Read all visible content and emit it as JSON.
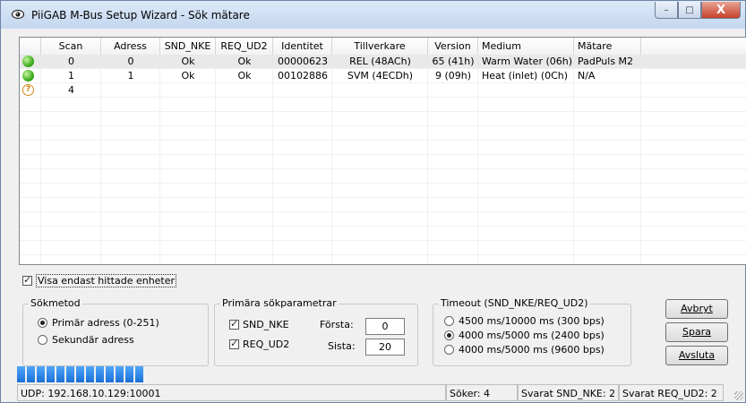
{
  "window": {
    "title": "PiiGAB M-Bus Setup Wizard - Sök mätare",
    "controls": {
      "minimize": "–",
      "maximize": "□",
      "close": "X"
    }
  },
  "table": {
    "columns": [
      "Scan",
      "Adress",
      "SND_NKE",
      "REQ_UD2",
      "Identitet",
      "Tillverkare",
      "Version",
      "Medium",
      "Mätare"
    ],
    "rows": [
      {
        "status": "green",
        "scan": "0",
        "adress": "0",
        "snd_nke": "Ok",
        "req_ud2": "Ok",
        "identitet": "00000623",
        "tillverkare": "REL (48ACh)",
        "version": "65 (41h)",
        "medium": "Warm Water (06h)",
        "matare": "PadPuls M2"
      },
      {
        "status": "green",
        "scan": "1",
        "adress": "1",
        "snd_nke": "Ok",
        "req_ud2": "Ok",
        "identitet": "00102886",
        "tillverkare": "SVM (4ECDh)",
        "version": "9 (09h)",
        "medium": "Heat (inlet) (0Ch)",
        "matare": "N/A"
      },
      {
        "status": "question",
        "scan": "4",
        "adress": "",
        "snd_nke": "",
        "req_ud2": "",
        "identitet": "",
        "tillverkare": "",
        "version": "",
        "medium": "",
        "matare": ""
      }
    ]
  },
  "show_found_only": {
    "label": "Visa endast hittade enheter",
    "checked": true
  },
  "search_method": {
    "title": "Sökmetod",
    "options": [
      {
        "label": "Primär adress (0-251)",
        "selected": true
      },
      {
        "label": "Sekundär adress",
        "selected": false
      }
    ]
  },
  "primary_params": {
    "title": "Primära sökparametrar",
    "snd_nke": {
      "label": "SND_NKE",
      "checked": true
    },
    "req_ud2": {
      "label": "REQ_UD2",
      "checked": true
    },
    "first": {
      "label": "Första:",
      "value": "0"
    },
    "last": {
      "label": "Sista:",
      "value": "20"
    }
  },
  "timeout": {
    "title": "Timeout (SND_NKE/REQ_UD2)",
    "options": [
      {
        "label": "4500 ms/10000 ms (300 bps)",
        "selected": false
      },
      {
        "label": "4000 ms/5000 ms (2400 bps)",
        "selected": true
      },
      {
        "label": "4000 ms/5000 ms (9600 bps)",
        "selected": false
      }
    ]
  },
  "buttons": {
    "abort": "Avbryt",
    "save": "Spara",
    "exit": "Avsluta"
  },
  "progress": {
    "blocks": 13,
    "fraction": 1.0
  },
  "statusbar": {
    "connection": "UDP: 192.168.10.129:10001",
    "searching": "Söker: 4",
    "snd_nke_count": "Svarat SND_NKE: 2",
    "req_ud2_count": "Svarat REQ_UD2: 2"
  }
}
